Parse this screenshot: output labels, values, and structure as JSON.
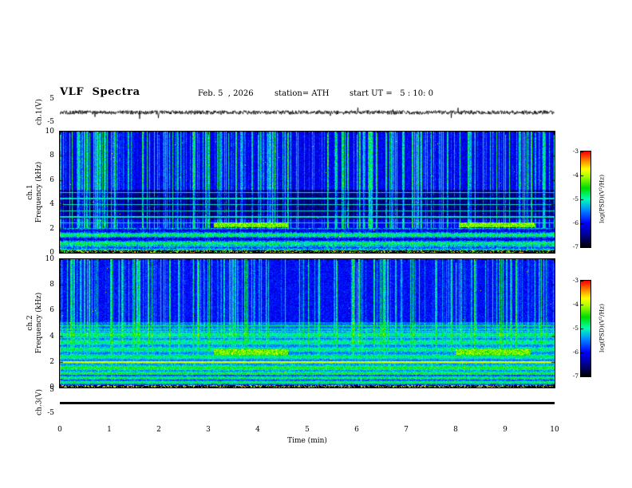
{
  "header": {
    "title": "VLF  Spectra",
    "date": "Feb. 5  , 2026",
    "station": "station= ATH",
    "start_ut": "start UT =   5 : 10: 0"
  },
  "panels": {
    "ch1_wave": {
      "label": "ch.1(V)",
      "ymax": "5",
      "ymin": "-5"
    },
    "ch1_spec": {
      "label_line1": "ch.1",
      "label_line2": "Frequency (kHz)"
    },
    "ch2_spec": {
      "label_line1": "ch.2",
      "label_line2": "Frequency (kHz)"
    },
    "ch3_wave": {
      "label": "ch.3(V)",
      "ymax": "5",
      "ymin": "-5"
    }
  },
  "xaxis": {
    "label": "Time  (min)",
    "ticks": [
      "0",
      "1",
      "2",
      "3",
      "4",
      "5",
      "6",
      "7",
      "8",
      "9",
      "10"
    ]
  },
  "colorbar": {
    "label": "log(PSD)(V²/Hz)",
    "ticks": [
      "-3",
      "-4",
      "-5",
      "-6",
      "-7"
    ]
  },
  "chart_data": [
    {
      "type": "line",
      "panel": "ch1_waveform",
      "ylabel": "ch.1 (V)",
      "xlim": [
        0,
        10
      ],
      "ylim": [
        -5,
        5
      ],
      "yticks": [
        5,
        -5
      ],
      "description": "Continuous broadband noise trace oscillating about 0 V, typical excursions ±1-2 V with occasional larger spikes across the full 10 minutes."
    },
    {
      "type": "heatmap",
      "panel": "ch1_spectrogram",
      "ylabel": "Frequency (kHz)",
      "xlabel": "Time (min)",
      "xlim": [
        0,
        10
      ],
      "ylim": [
        0,
        10
      ],
      "yticks": [
        10,
        8,
        6,
        4,
        2,
        0
      ],
      "zlim": [
        -7,
        -3
      ],
      "zlabel": "log(PSD)(V²/Hz)",
      "features": {
        "background_psd": -6.1,
        "quiet_band_khz": [
          2.8,
          5.2
        ],
        "bright_low_band_khz": [
          0.2,
          2.1
        ],
        "line_freqs_khz": [
          2.5,
          3.0,
          3.5,
          4.0,
          4.5,
          5.0
        ],
        "hot_patches": [
          {
            "t_min": [
              3.1,
              4.6
            ],
            "f_khz": [
              2.15,
              2.5
            ],
            "psd": -4.2
          },
          {
            "t_min": [
              8.05,
              9.6
            ],
            "f_khz": [
              2.15,
              2.5
            ],
            "psd": -4.2
          }
        ],
        "vertical_streaks": "dense impulsive broadband streaks (sferics) spanning 0-10 kHz over entire record",
        "bottom_band": "near-zero frequency band at noise floor (-7) with speckles"
      }
    },
    {
      "type": "heatmap",
      "panel": "ch2_spectrogram",
      "ylabel": "Frequency (kHz)",
      "xlabel": "Time (min)",
      "xlim": [
        0,
        10
      ],
      "ylim": [
        0,
        10
      ],
      "yticks": [
        10,
        8,
        6,
        4,
        2,
        0
      ],
      "zlim": [
        -7,
        -3
      ],
      "zlabel": "log(PSD)(V²/Hz)",
      "features": {
        "background_psd": -6.0,
        "bright_low_band_khz": [
          0.2,
          4.6
        ],
        "strong_line_khz": 2.0,
        "line_freqs_khz": [
          2.5,
          2.9,
          3.4,
          3.9,
          4.4,
          4.85
        ],
        "hot_patches": [
          {
            "t_min": [
              3.1,
              4.6
            ],
            "f_khz": [
              2.55,
              3.0
            ],
            "psd": -4.2
          },
          {
            "t_min": [
              8.0,
              9.5
            ],
            "f_khz": [
              2.55,
              3.0
            ],
            "psd": -4.2
          }
        ],
        "vertical_streaks": "dense impulsive broadband streaks, strongest above 5 kHz",
        "bottom_band": "near-zero frequency band at noise floor (-7) with speckles"
      }
    },
    {
      "type": "line",
      "panel": "ch3_waveform",
      "ylabel": "ch.3 (V)",
      "xlim": [
        0,
        10
      ],
      "ylim": [
        -5,
        5
      ],
      "yticks": [
        5,
        -5
      ],
      "description": "Perfectly flat line at 0 V for the entire record (channel inactive)."
    }
  ]
}
